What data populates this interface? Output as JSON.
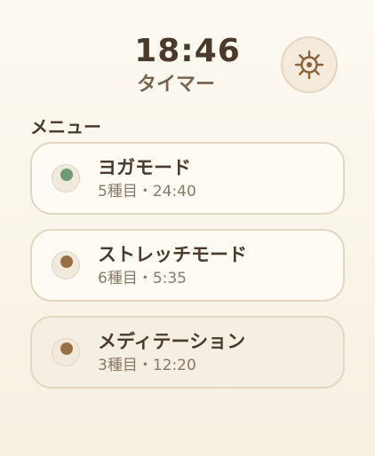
{
  "header": {
    "time": "18:46",
    "title": "タイマー",
    "settings_icon": "gear-icon"
  },
  "menu": {
    "label": "メニュー",
    "items": [
      {
        "title": "ヨガモード",
        "meta": "5種目・24:40",
        "dot_color": "#6f9a72",
        "selected": false
      },
      {
        "title": "ストレッチモード",
        "meta": "6種目・5:35",
        "dot_color": "#9a6f45",
        "selected": false
      },
      {
        "title": "メディテーション",
        "meta": "3種目・12:20",
        "dot_color": "#9a6f45",
        "selected": true
      }
    ]
  }
}
